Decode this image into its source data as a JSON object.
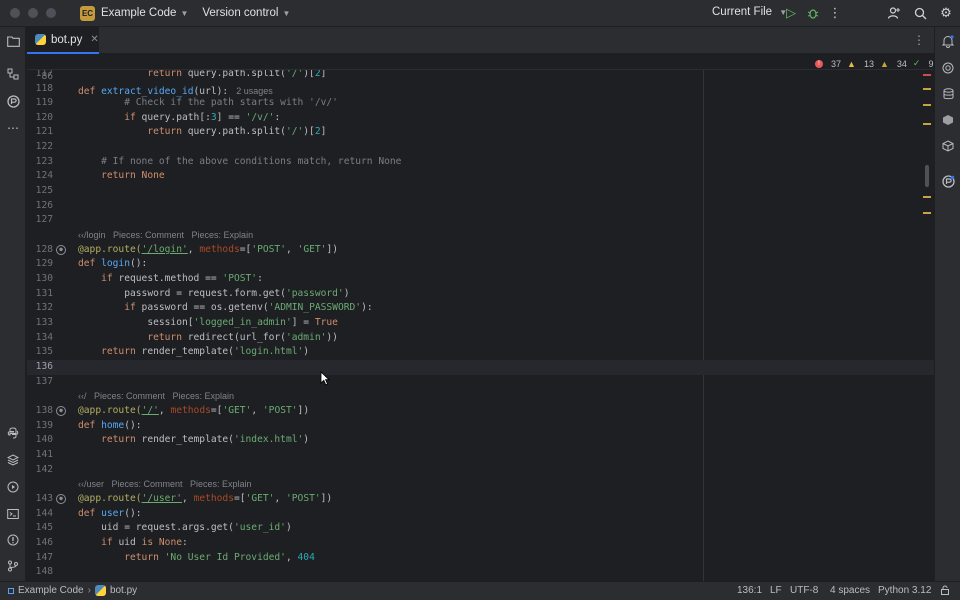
{
  "titlebar": {
    "project_badge": "EC",
    "project_name": "Example Code",
    "vcs_label": "Version control",
    "run_config": "Current File"
  },
  "tab": {
    "label": "bot.py"
  },
  "sticky": {
    "num": "86",
    "sig_def": "def ",
    "sig_fn": "extract_video_id",
    "sig_rest": "(url):",
    "usages": "2 usages"
  },
  "inspection": {
    "errors": "37",
    "warnings": "13",
    "weak_warnings": "34",
    "ok": "9"
  },
  "lines": [
    {
      "n": "117"
    },
    {
      "n": "118"
    },
    {
      "n": "119"
    },
    {
      "n": "120"
    },
    {
      "n": "121"
    },
    {
      "n": "122"
    },
    {
      "n": "123"
    },
    {
      "n": "124"
    },
    {
      "n": "125"
    },
    {
      "n": "126"
    },
    {
      "n": "127"
    },
    {
      "n": "128"
    },
    {
      "n": "129"
    },
    {
      "n": "130"
    },
    {
      "n": "131"
    },
    {
      "n": "132"
    },
    {
      "n": "133"
    },
    {
      "n": "134"
    },
    {
      "n": "135"
    },
    {
      "n": "136"
    },
    {
      "n": "137"
    },
    {
      "n": "138"
    },
    {
      "n": "139"
    },
    {
      "n": "140"
    },
    {
      "n": "141"
    },
    {
      "n": "142"
    },
    {
      "n": "143"
    },
    {
      "n": "144"
    },
    {
      "n": "145"
    },
    {
      "n": "146"
    },
    {
      "n": "147"
    },
    {
      "n": "148"
    }
  ],
  "inlays": {
    "login": "‹‹/login   Pieces: Comment   Pieces: Explain",
    "home": "‹‹/   Pieces: Comment   Pieces: Explain",
    "user": "‹‹/user   Pieces: Comment   Pieces: Explain"
  },
  "code": {
    "l117_a": "return",
    "l117_b": " query.path.split(",
    "l117_c": "'/'",
    "l117_d": ")[",
    "l117_e": "2",
    "l117_f": "]",
    "l119": "# Check if the path starts with '/v/'",
    "l120_a": "if",
    "l120_b": " query.path[:",
    "l120_c": "3",
    "l120_d": "] == ",
    "l120_e": "'/v/'",
    "l120_f": ":",
    "l121_a": "return",
    "l121_b": " query.path.split(",
    "l121_c": "'/'",
    "l121_d": ")[",
    "l121_e": "2",
    "l121_f": "]",
    "l123": "# If none of the above conditions match, return None",
    "l124_a": "return",
    "l124_b": " None",
    "l128_a": "@app.route(",
    "l128_b": "'/login'",
    "l128_c": ", ",
    "l128_d": "methods",
    "l128_e": "=[",
    "l128_f": "'POST'",
    "l128_g": ", ",
    "l128_h": "'GET'",
    "l128_i": "])",
    "l129_a": "def",
    "l129_b": " ",
    "l129_c": "login",
    "l129_d": "():",
    "l130_a": "if",
    "l130_b": " request.method == ",
    "l130_c": "'POST'",
    "l130_d": ":",
    "l131_a": "password = request.form.get(",
    "l131_b": "'password'",
    "l131_c": ")",
    "l132_a": "if",
    "l132_b": " password == os.getenv(",
    "l132_c": "'ADMIN_PASSWORD'",
    "l132_d": "):",
    "l133_a": "session[",
    "l133_b": "'logged_in_admin'",
    "l133_c": "] = ",
    "l133_d": "True",
    "l134_a": "return",
    "l134_b": " redirect(url_for(",
    "l134_c": "'admin'",
    "l134_d": "))",
    "l135_a": "return",
    "l135_b": " render_template(",
    "l135_c": "'login.html'",
    "l135_d": ")",
    "l138_a": "@app.route(",
    "l138_b": "'/'",
    "l138_c": ", ",
    "l138_d": "methods",
    "l138_e": "=[",
    "l138_f": "'GET'",
    "l138_g": ", ",
    "l138_h": "'POST'",
    "l138_i": "])",
    "l139_a": "def",
    "l139_b": " ",
    "l139_c": "home",
    "l139_d": "():",
    "l140_a": "return",
    "l140_b": " render_template(",
    "l140_c": "'index.html'",
    "l140_d": ")",
    "l143_a": "@app.route(",
    "l143_b": "'/user'",
    "l143_c": ", ",
    "l143_d": "methods",
    "l143_e": "=[",
    "l143_f": "'GET'",
    "l143_g": ", ",
    "l143_h": "'POST'",
    "l143_i": "])",
    "l144_a": "def",
    "l144_b": " ",
    "l144_c": "user",
    "l144_d": "():",
    "l145_a": "uid = request.args.get(",
    "l145_b": "'user_id'",
    "l145_c": ")",
    "l146_a": "if",
    "l146_b": " uid ",
    "l146_c": "is",
    "l146_d": " None",
    "l146_e": ":",
    "l147_a": "return",
    "l147_b": " ",
    "l147_c": "'No User Id Provided'",
    "l147_d": ", ",
    "l147_e": "404"
  },
  "statusbar": {
    "project": "Example Code",
    "file": "bot.py",
    "position": "136:1",
    "line_sep": "LF",
    "encoding": "UTF-8",
    "indent": "4 spaces",
    "interpreter": "Python 3.12"
  },
  "colors": {
    "accent": "#3574f0",
    "error": "#e55b5b",
    "warning": "#e7b93f",
    "ok": "#5fb865"
  }
}
